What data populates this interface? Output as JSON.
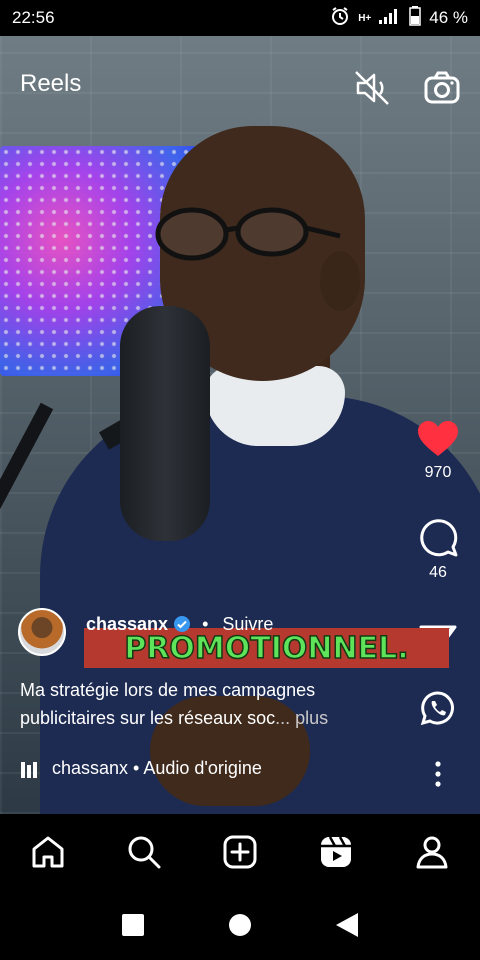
{
  "status_bar": {
    "time": "22:56",
    "battery": "46 %",
    "network": "H+"
  },
  "header": {
    "title": "Reels",
    "icons": [
      "mute-icon",
      "camera-icon"
    ]
  },
  "actions": {
    "likes": "970",
    "comments": "46",
    "icons": [
      "heart-icon",
      "comment-icon",
      "share-icon",
      "whatsapp-icon",
      "more-icon"
    ]
  },
  "post": {
    "username": "chassanx",
    "separator": "•",
    "follow_label": "Suivre",
    "overlay_text": "PROMOTIONNEL.",
    "caption": "Ma stratégie lors de mes campagnes publicitaires sur les réseaux soc",
    "more_label": "... plus",
    "audio": "chassanx • Audio d'origine"
  },
  "bottom_nav": {
    "items": [
      "home-icon",
      "search-icon",
      "create-icon",
      "reels-icon",
      "profile-icon"
    ]
  },
  "colors": {
    "like": "#ff3040",
    "verified": "#3897f0",
    "overlay_bg": "#b6392f",
    "overlay_text": "#5ee35a"
  }
}
